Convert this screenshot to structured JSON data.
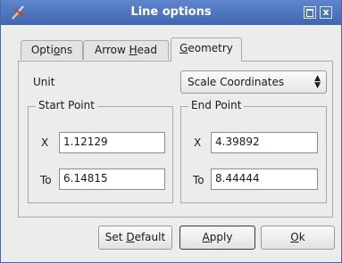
{
  "window": {
    "title": "Line options"
  },
  "tabs": [
    {
      "pre": "Opti",
      "mn": "o",
      "post": "ns"
    },
    {
      "pre": "Arrow ",
      "mn": "H",
      "post": "ead"
    },
    {
      "pre": "",
      "mn": "G",
      "post": "eometry"
    }
  ],
  "active_tab": "Geometry",
  "unit": {
    "label": "Unit",
    "value": "Scale Coordinates"
  },
  "start_point": {
    "title": "Start Point",
    "x_label": "X",
    "x_value": "1.12129",
    "to_label": "To",
    "to_value": "6.14815"
  },
  "end_point": {
    "title": "End Point",
    "x_label": "X",
    "x_value": "4.39892",
    "to_label": "To",
    "to_value": "8.44444"
  },
  "buttons": {
    "set_default": {
      "pre": "Set ",
      "mn": "D",
      "post": "efault"
    },
    "apply": {
      "pre": "",
      "mn": "A",
      "post": "pply"
    },
    "ok": {
      "pre": "",
      "mn": "O",
      "post": "k"
    }
  },
  "titlebar_buttons": {
    "close": "x"
  },
  "colors": {
    "titlebar": "#4a72bd",
    "window_bg": "#ececec"
  },
  "icons": {
    "app": "app-icon",
    "maximize": "maximize-icon",
    "close": "close-icon",
    "combo": "combo-arrows-icon"
  }
}
